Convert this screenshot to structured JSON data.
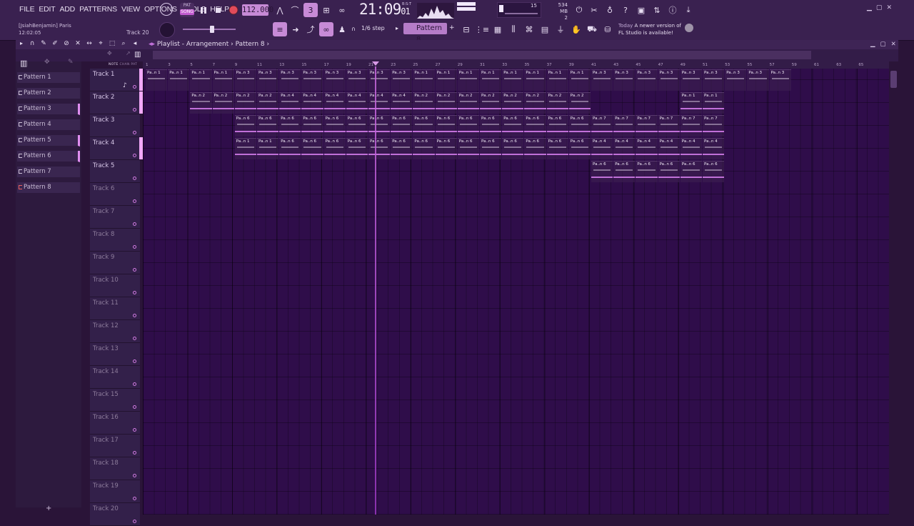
{
  "menu": [
    "FILE",
    "EDIT",
    "ADD",
    "PATTERNS",
    "VIEW",
    "OPTIONS",
    "TOOLS",
    "HELP"
  ],
  "transport": {
    "mode_pat": "PAT",
    "mode_song": "SONG",
    "tempo": "112.000",
    "clock": "21:09",
    "clock_sub": "01",
    "clock_small": "B:S:T"
  },
  "monitor": {
    "cpu": "15",
    "mem_mb": "534 MB",
    "mem_sub": "2"
  },
  "hint": {
    "user": "[JsiahBenjamin] Paris",
    "time": "12:02:05",
    "track": "Track 20"
  },
  "snap": {
    "step": "1/6 step"
  },
  "pattern_selector": "Pattern 8",
  "news": {
    "today": "Today",
    "line1": "A newer version of",
    "line2": "FL Studio is available!"
  },
  "playlist": {
    "title": "Playlist - Arrangement",
    "current_pattern": "Pattern 8",
    "picker_tabs": [
      "NOTE",
      "CHAN",
      "PAT"
    ],
    "patterns": [
      "Pattern 1",
      "Pattern 2",
      "Pattern 3",
      "Pattern 4",
      "Pattern 5",
      "Pattern 6",
      "Pattern 7",
      "Pattern 8"
    ],
    "ruler": [
      "1",
      "3",
      "5",
      "7",
      "9",
      "11",
      "13",
      "15",
      "17",
      "19",
      "21",
      "23",
      "25",
      "27",
      "29",
      "31",
      "33",
      "35",
      "37",
      "39",
      "41",
      "43",
      "45",
      "47",
      "49",
      "51",
      "53",
      "55",
      "57",
      "59",
      "61",
      "63",
      "65"
    ],
    "tracks": [
      "Track 1",
      "Track 2",
      "Track 3",
      "Track 4",
      "Track 5",
      "Track 6",
      "Track 7",
      "Track 8",
      "Track 9",
      "Track 10",
      "Track 11",
      "Track 12",
      "Track 13",
      "Track 14",
      "Track 15",
      "Track 16",
      "Track 17",
      "Track 18",
      "Track 19",
      "Track 20"
    ],
    "clips": [
      {
        "track": 0,
        "bar": 1,
        "len": 8,
        "label": "Pa..n 1"
      },
      {
        "track": 0,
        "bar": 9,
        "len": 16,
        "label": "Pa..n 3"
      },
      {
        "track": 0,
        "bar": 25,
        "len": 16,
        "label": "Pa..n 1"
      },
      {
        "track": 0,
        "bar": 41,
        "len": 17,
        "label": "Pa..n 3"
      },
      {
        "track": 1,
        "bar": 5,
        "len": 4,
        "label": "Pa..n 2"
      },
      {
        "track": 1,
        "bar": 9,
        "len": 4,
        "label": "Pa..n 2"
      },
      {
        "track": 1,
        "bar": 13,
        "len": 12,
        "label": "Pa..n 4"
      },
      {
        "track": 1,
        "bar": 25,
        "len": 16,
        "label": "Pa..n 2"
      },
      {
        "track": 1,
        "bar": 49,
        "len": 4,
        "label": "Pa..n 1"
      },
      {
        "track": 2,
        "bar": 9,
        "len": 4,
        "label": "Pa..n 6"
      },
      {
        "track": 2,
        "bar": 13,
        "len": 12,
        "label": "Pa..n 6"
      },
      {
        "track": 2,
        "bar": 25,
        "len": 16,
        "label": "Pa..n 6"
      },
      {
        "track": 2,
        "bar": 41,
        "len": 12,
        "label": "Pa..n 7"
      },
      {
        "track": 3,
        "bar": 9,
        "len": 4,
        "label": "Pa..n 1"
      },
      {
        "track": 3,
        "bar": 13,
        "len": 12,
        "label": "Pa..n 6"
      },
      {
        "track": 3,
        "bar": 25,
        "len": 16,
        "label": "Pa..n 6"
      },
      {
        "track": 3,
        "bar": 41,
        "len": 12,
        "label": "Pa..n 4"
      },
      {
        "track": 4,
        "bar": 41,
        "len": 12,
        "label": "Pa..n 6"
      }
    ]
  },
  "colors": {
    "accent": "#c25bd0",
    "grid": "#2f0d4a",
    "playhead": "#c96bdf"
  },
  "icons": [
    "metronome-icon",
    "record-icon",
    "play-pause-icon",
    "stop-icon",
    "snap-magnet-icon",
    "draw-pencil-icon",
    "paint-brush-icon",
    "delete-icon",
    "mute-icon",
    "slip-icon",
    "slice-icon",
    "select-icon",
    "zoom-icon",
    "playback-icon",
    "mixer-icon",
    "piano-roll-icon",
    "channel-rack-icon",
    "browser-icon",
    "plugin-picker-icon",
    "news-icon"
  ]
}
